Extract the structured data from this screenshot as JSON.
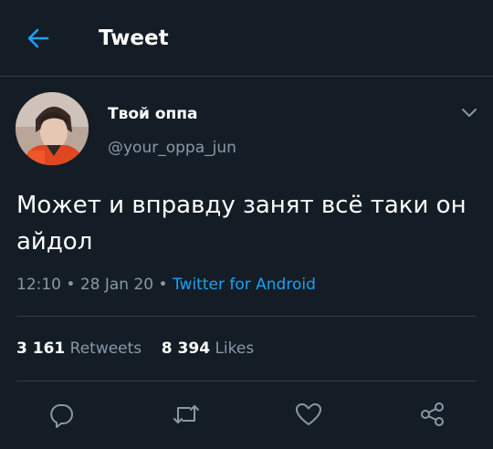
{
  "header": {
    "title": "Tweet",
    "back_icon": "arrow-left-icon"
  },
  "colors": {
    "background": "#141d26",
    "accent": "#1da1f2",
    "secondary_text": "#8899a6",
    "divider": "#2f3b47"
  },
  "author": {
    "display_name": "Твой оппа",
    "handle": "@your_oppa_jun"
  },
  "tweet": {
    "text": "Может и вправду занят всё таки он айдол",
    "time": "12:10",
    "sep1": " • ",
    "date": "28 Jan 20",
    "sep2": " • ",
    "source": "Twitter for Android"
  },
  "stats": {
    "retweets_count": "3 161",
    "retweets_label": "Retweets",
    "likes_count": "8 394",
    "likes_label": "Likes"
  },
  "actions": [
    "reply-icon",
    "retweet-icon",
    "like-icon",
    "share-icon"
  ]
}
